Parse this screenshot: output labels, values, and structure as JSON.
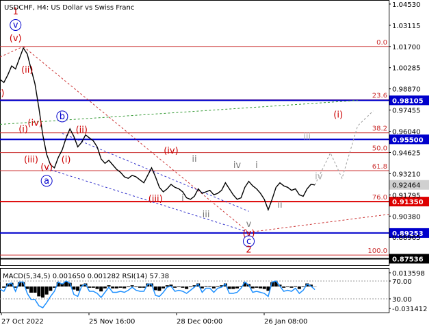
{
  "chart_data": {
    "type": "line",
    "title": "USDCHF, H4:  US Dollar vs Swiss Franc",
    "ylim": [
      0.871,
      1.048
    ],
    "y_ticks": [
      "1.04530",
      "1.03115",
      "1.01700",
      "1.00285",
      "0.98870",
      "0.97455",
      "0.96040",
      "0.94625",
      "0.93210",
      "0.91795",
      "0.90380",
      "0.88965"
    ],
    "x_ticks": [
      "27 Oct 2022",
      "25 Nov 16:00",
      "28 Dec 00:00",
      "26 Jan 08:00"
    ],
    "price_series": [
      [
        0.0,
        0.995
      ],
      [
        0.01,
        0.993
      ],
      [
        0.02,
        0.998
      ],
      [
        0.03,
        1.004
      ],
      [
        0.04,
        1.002
      ],
      [
        0.05,
        1.009
      ],
      [
        0.06,
        1.016
      ],
      [
        0.07,
        1.012
      ],
      [
        0.08,
        1.002
      ],
      [
        0.09,
        0.992
      ],
      [
        0.1,
        0.976
      ],
      [
        0.11,
        0.958
      ],
      [
        0.12,
        0.945
      ],
      [
        0.13,
        0.938
      ],
      [
        0.14,
        0.936
      ],
      [
        0.15,
        0.943
      ],
      [
        0.16,
        0.948
      ],
      [
        0.17,
        0.956
      ],
      [
        0.18,
        0.962
      ],
      [
        0.19,
        0.957
      ],
      [
        0.2,
        0.95
      ],
      [
        0.21,
        0.953
      ],
      [
        0.22,
        0.958
      ],
      [
        0.23,
        0.956
      ],
      [
        0.24,
        0.954
      ],
      [
        0.25,
        0.95
      ],
      [
        0.26,
        0.942
      ],
      [
        0.27,
        0.939
      ],
      [
        0.28,
        0.941
      ],
      [
        0.29,
        0.938
      ],
      [
        0.3,
        0.935
      ],
      [
        0.31,
        0.933
      ],
      [
        0.32,
        0.93
      ],
      [
        0.33,
        0.929
      ],
      [
        0.34,
        0.931
      ],
      [
        0.35,
        0.93
      ],
      [
        0.36,
        0.928
      ],
      [
        0.37,
        0.926
      ],
      [
        0.38,
        0.931
      ],
      [
        0.39,
        0.936
      ],
      [
        0.4,
        0.93
      ],
      [
        0.41,
        0.923
      ],
      [
        0.42,
        0.92
      ],
      [
        0.43,
        0.922
      ],
      [
        0.44,
        0.925
      ],
      [
        0.45,
        0.923
      ],
      [
        0.46,
        0.922
      ],
      [
        0.47,
        0.92
      ],
      [
        0.48,
        0.916
      ],
      [
        0.49,
        0.915
      ],
      [
        0.5,
        0.917
      ],
      [
        0.51,
        0.922
      ],
      [
        0.52,
        0.919
      ],
      [
        0.53,
        0.92
      ],
      [
        0.54,
        0.921
      ],
      [
        0.55,
        0.918
      ],
      [
        0.56,
        0.919
      ],
      [
        0.57,
        0.921
      ],
      [
        0.58,
        0.926
      ],
      [
        0.59,
        0.922
      ],
      [
        0.6,
        0.918
      ],
      [
        0.61,
        0.915
      ],
      [
        0.62,
        0.916
      ],
      [
        0.63,
        0.923
      ],
      [
        0.64,
        0.927
      ],
      [
        0.65,
        0.924
      ],
      [
        0.66,
        0.922
      ],
      [
        0.67,
        0.919
      ],
      [
        0.68,
        0.915
      ],
      [
        0.69,
        0.908
      ],
      [
        0.7,
        0.915
      ],
      [
        0.71,
        0.923
      ],
      [
        0.72,
        0.926
      ],
      [
        0.73,
        0.924
      ],
      [
        0.74,
        0.923
      ],
      [
        0.75,
        0.921
      ],
      [
        0.76,
        0.922
      ],
      [
        0.77,
        0.918
      ],
      [
        0.78,
        0.917
      ],
      [
        0.79,
        0.922
      ],
      [
        0.8,
        0.925
      ],
      [
        0.81,
        0.9246
      ]
    ],
    "forecast_path": [
      [
        0.81,
        0.9246
      ],
      [
        0.85,
        0.946
      ],
      [
        0.88,
        0.929
      ],
      [
        0.92,
        0.964
      ],
      [
        0.96,
        0.974
      ]
    ],
    "fib_levels": [
      {
        "label": "0.0",
        "value": 1.017
      },
      {
        "label": "23.6",
        "value": 0.9814
      },
      {
        "label": "38.2",
        "value": 0.9594
      },
      {
        "label": "50.0",
        "value": 0.9462
      },
      {
        "label": "61.8",
        "value": 0.9341
      },
      {
        "label": "76.0",
        "value": 0.9135
      },
      {
        "label": "100.0",
        "value": 0.8778
      }
    ],
    "key_levels": [
      {
        "label": "0.98105",
        "value": 0.98105,
        "color": "#0000cc"
      },
      {
        "label": "0.95500",
        "value": 0.955,
        "color": "#0000cc"
      },
      {
        "label": "0.91350",
        "value": 0.9135,
        "color": "#dd0000"
      },
      {
        "label": "0.89253",
        "value": 0.89253,
        "color": "#0000cc"
      },
      {
        "label": "0.87536",
        "value": 0.87536,
        "color": "#000000"
      }
    ],
    "current_price": {
      "label": "0.92464",
      "value": 0.92464
    },
    "wave_labels": [
      {
        "text": "1",
        "x": 0.04,
        "y": 1.0385,
        "color": "#cc0000"
      },
      {
        "text": "v",
        "x": 0.04,
        "y": 1.0295,
        "color": "#0000cc",
        "circle": true
      },
      {
        "text": "(v)",
        "x": 0.04,
        "y": 1.0205,
        "color": "#cc0000"
      },
      {
        "text": "(ii)",
        "x": 0.07,
        "y": 0.9995,
        "color": "#cc0000"
      },
      {
        "text": "v)",
        "x": 0.0,
        "y": 0.984,
        "color": "#cc0000"
      },
      {
        "text": "(i)",
        "x": 0.06,
        "y": 0.96,
        "color": "#cc0000"
      },
      {
        "text": "(iv)",
        "x": 0.09,
        "y": 0.964,
        "color": "#cc0000"
      },
      {
        "text": "(iii)",
        "x": 0.08,
        "y": 0.9395,
        "color": "#cc0000"
      },
      {
        "text": "(v)",
        "x": 0.12,
        "y": 0.9345,
        "color": "#cc0000"
      },
      {
        "text": "a",
        "x": 0.12,
        "y": 0.9255,
        "color": "#0000cc",
        "circle": true
      },
      {
        "text": "b",
        "x": 0.16,
        "y": 0.9685,
        "color": "#0000cc",
        "circle": true
      },
      {
        "text": "(ii)",
        "x": 0.21,
        "y": 0.9595,
        "color": "#cc0000"
      },
      {
        "text": "(i)",
        "x": 0.17,
        "y": 0.9395,
        "color": "#cc0000"
      },
      {
        "text": "(iv)",
        "x": 0.44,
        "y": 0.9455,
        "color": "#cc0000"
      },
      {
        "text": "(iii)",
        "x": 0.4,
        "y": 0.9135,
        "color": "#cc0000"
      },
      {
        "text": "ii",
        "x": 0.5,
        "y": 0.94,
        "color": "#777777"
      },
      {
        "text": "i",
        "x": 0.47,
        "y": 0.914,
        "color": "#777777"
      },
      {
        "text": "iii",
        "x": 0.53,
        "y": 0.903,
        "color": "#777777"
      },
      {
        "text": "iv",
        "x": 0.61,
        "y": 0.936,
        "color": "#777777"
      },
      {
        "text": "i",
        "x": 0.66,
        "y": 0.936,
        "color": "#777777"
      },
      {
        "text": "v",
        "x": 0.64,
        "y": 0.8965,
        "color": "#777777"
      },
      {
        "text": "(v)",
        "x": 0.64,
        "y": 0.8905,
        "color": "#cc0000"
      },
      {
        "text": "c",
        "x": 0.64,
        "y": 0.8852,
        "color": "#0000cc",
        "circle": true
      },
      {
        "text": "2",
        "x": 0.64,
        "y": 0.8795,
        "color": "#cc0000"
      },
      {
        "text": "ii",
        "x": 0.72,
        "y": 0.9095,
        "color": "#777777"
      },
      {
        "text": "iii",
        "x": 0.79,
        "y": 0.955,
        "color": "#aaaaaa"
      },
      {
        "text": "iv",
        "x": 0.82,
        "y": 0.9285,
        "color": "#aaaaaa"
      },
      {
        "text": "(i)",
        "x": 0.87,
        "y": 0.9695,
        "color": "#cc0000"
      }
    ],
    "indicator": {
      "label": "MACD(5,34,5) 0.001650 0.001282 RSI(14) 57.38",
      "y_ticks": [
        "0.013598",
        "70.00",
        "30.00",
        "-0.031412"
      ]
    }
  }
}
